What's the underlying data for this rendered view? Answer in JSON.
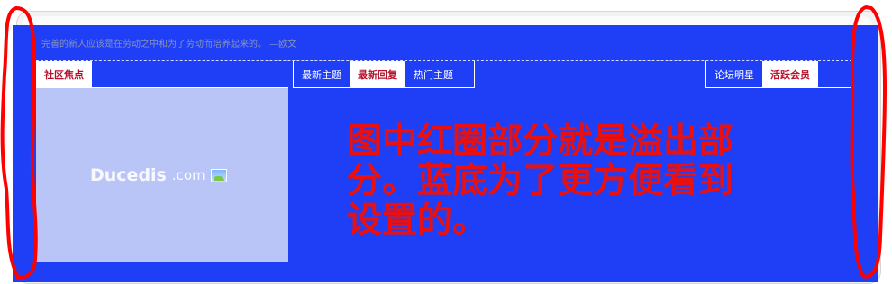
{
  "quote": "完善的新人应该是在劳动之中和为了劳动而培养起来的。 —欧文",
  "tabs_left": [
    "社区焦点"
  ],
  "tabs_middle": [
    "最新主题",
    "最新回复",
    "热门主题"
  ],
  "tabs_right": [
    "论坛明星",
    "活跃会员"
  ],
  "image_placeholder": {
    "logo_text": "Ducedis",
    "logo_suffix": ".com",
    "icon": "image-icon"
  },
  "annotation": "图中红圈部分就是溢出部分。蓝底为了更方便看到设置的。",
  "colors": {
    "panel_blue": "#1f3ff7",
    "active_tab_text": "#b5102b",
    "annotation_red": "#e81010"
  }
}
